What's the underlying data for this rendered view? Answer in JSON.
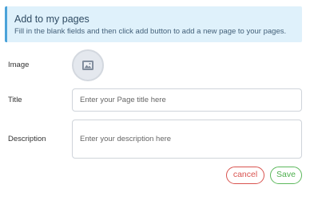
{
  "banner": {
    "title": "Add to my pages",
    "text": "Fill in the blank fields and then click add button to add a new page to your pages."
  },
  "form": {
    "image_label": "Image",
    "image_icon": "image-icon",
    "title_label": "Title",
    "title_placeholder": "Enter your Page title here",
    "title_value": "",
    "description_label": "Description",
    "description_placeholder": "Enter your description here",
    "description_value": ""
  },
  "actions": {
    "cancel_label": "cancel",
    "save_label": "Save"
  },
  "colors": {
    "banner_bg": "#dff1fb",
    "banner_accent": "#4ba3d9",
    "cancel": "#d9534f",
    "save": "#5cb85c"
  }
}
